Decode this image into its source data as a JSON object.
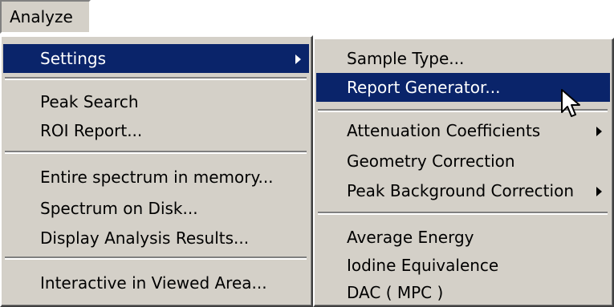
{
  "menubar": {
    "analyze_label": "Analyze"
  },
  "main_menu": {
    "settings": "Settings",
    "peak_search": "Peak Search",
    "roi_report": "ROI Report...",
    "entire_spectrum": "Entire spectrum in memory...",
    "spectrum_on_disk": "Spectrum on Disk...",
    "display_analysis": "Display Analysis Results...",
    "interactive": "Interactive in Viewed Area..."
  },
  "settings_submenu": {
    "sample_type": "Sample Type...",
    "report_generator": "Report Generator...",
    "attenuation": "Attenuation Coefficients",
    "geometry": "Geometry Correction",
    "peak_background": "Peak Background Correction",
    "average_energy": "Average Energy",
    "iodine": "Iodine Equivalence",
    "dac": "DAC ( MPC )"
  },
  "colors": {
    "menu_face": "#d4d0c8",
    "highlight": "#0a246a",
    "highlight_text": "#ffffff"
  },
  "icons": {
    "cursor": "mouse-pointer-icon",
    "submenu": "submenu-arrow-icon"
  }
}
